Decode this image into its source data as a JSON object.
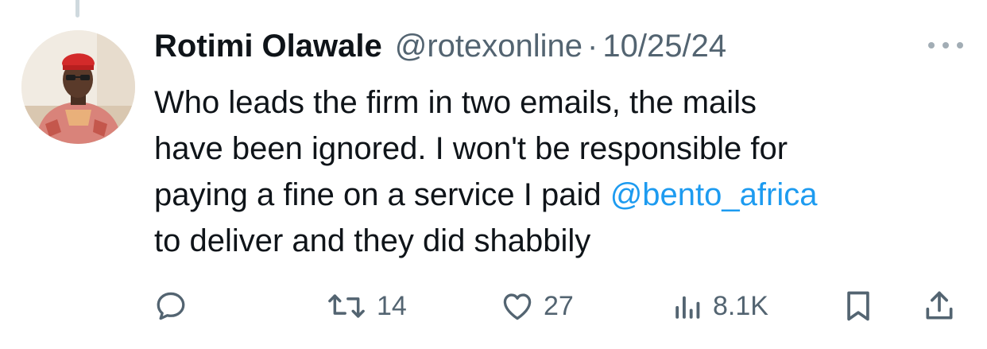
{
  "tweet": {
    "author_name": "Rotimi Olawale",
    "handle": "@rotexonline",
    "separator": "·",
    "date": "10/25/24",
    "text_lines": [
      {
        "before": "Who leads the firm in two emails, the mails",
        "mention": "",
        "after": ""
      },
      {
        "before": "have been ignored. I won't be responsible for",
        "mention": "",
        "after": ""
      },
      {
        "before": "paying a fine on a service I paid ",
        "mention": "@bento_africa",
        "after": ""
      },
      {
        "before": "to deliver and they did shabbily",
        "mention": "",
        "after": ""
      }
    ]
  },
  "actions": {
    "reply": {
      "icon": "reply-icon",
      "count": ""
    },
    "retweet": {
      "icon": "retweet-icon",
      "count": "14"
    },
    "like": {
      "icon": "heart-icon",
      "count": "27"
    },
    "views": {
      "icon": "views-icon",
      "count": "8.1K"
    },
    "bookmark": {
      "icon": "bookmark-icon"
    },
    "share": {
      "icon": "share-icon"
    }
  },
  "colors": {
    "text": "#0f1419",
    "muted": "#536471",
    "accent": "#1d9bf0",
    "thread_line": "#cfd9de"
  }
}
